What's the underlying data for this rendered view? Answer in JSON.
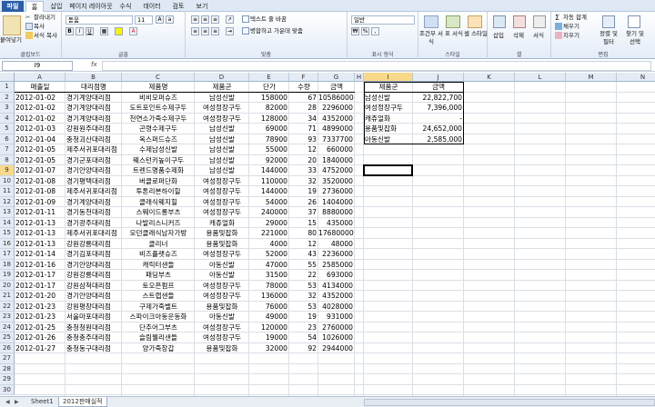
{
  "ribbon_tabs": [
    "파일",
    "홈",
    "삽입",
    "페이지 레이아웃",
    "수식",
    "데이터",
    "검토",
    "보기"
  ],
  "ribbon": {
    "clipboard": {
      "paste": "붙여넣기",
      "cut": "잘라내기",
      "copy": "복사",
      "format_painter": "서식 복사",
      "label": "클립보드"
    },
    "font": {
      "name": "돋움",
      "size": "11",
      "label": "글꼴"
    },
    "alignment": {
      "wrap": "텍스트 줄 바꿈",
      "merge": "병합하고 가운데 맞춤",
      "label": "맞춤"
    },
    "number": {
      "format": "일반",
      "label": "표시 형식"
    },
    "styles": {
      "conditional": "조건부 서식",
      "table": "표 서식",
      "cell": "셀 스타일",
      "label": "스타일"
    },
    "cells": {
      "insert": "삽입",
      "delete": "삭제",
      "format": "서식",
      "label": "셀"
    },
    "editing": {
      "autosum": "자동 합계",
      "fill": "채우기",
      "clear": "지우기",
      "sort": "정렬 및 필터",
      "find": "찾기 및 선택",
      "label": "편집"
    }
  },
  "formula_bar": {
    "name_box": "I9",
    "fx": "fx",
    "value": ""
  },
  "columns": [
    "A",
    "B",
    "C",
    "D",
    "E",
    "F",
    "G",
    "H",
    "I",
    "J",
    "K",
    "L",
    "M",
    "N"
  ],
  "headers": [
    "매출일",
    "대리점명",
    "제품명",
    "제품군",
    "단가",
    "수량",
    "금액"
  ],
  "rows": [
    [
      "2012-01-02",
      "경기계양대리점",
      "비비모퍼슈즈",
      "남성신발",
      "158000",
      "67",
      "10586000"
    ],
    [
      "2012-01-02",
      "경기계양대리점",
      "도트포인트수제구두",
      "여성정장구두",
      "82000",
      "28",
      "2296000"
    ],
    [
      "2012-01-02",
      "경기계양대리점",
      "천연소가죽수제구두",
      "여성정장구두",
      "128000",
      "34",
      "4352000"
    ],
    [
      "2012-01-03",
      "강원원주대리점",
      "곤령수제구두",
      "남성신발",
      "69000",
      "71",
      "4899000"
    ],
    [
      "2012-01-04",
      "충청괴산대리점",
      "옥스퍼드슈즈",
      "남성신발",
      "78900",
      "93",
      "7337700"
    ],
    [
      "2012-01-05",
      "제주서귀포대리점",
      "수제남성신발",
      "남성신발",
      "55000",
      "12",
      "660000"
    ],
    [
      "2012-01-05",
      "경기군포대리점",
      "웨스턴키높이구두",
      "남성신발",
      "92000",
      "20",
      "1840000"
    ],
    [
      "2012-01-07",
      "경기안양대리점",
      "트렌드명품수제화",
      "남성신발",
      "144000",
      "33",
      "4752000"
    ],
    [
      "2012-01-08",
      "경기평택대리점",
      "버클로퍼단화",
      "여성정장구두",
      "110000",
      "32",
      "3520000"
    ],
    [
      "2012-01-08",
      "제주서귀포대리점",
      "투톤리본하이힐",
      "여성정장구두",
      "144000",
      "19",
      "2736000"
    ],
    [
      "2012-01-09",
      "경기계양대리점",
      "클래식웨지힐",
      "여성정장구두",
      "54000",
      "26",
      "1404000"
    ],
    [
      "2012-01-11",
      "경기동천대리점",
      "스웨이드롱부츠",
      "여성정장구두",
      "240000",
      "37",
      "8880000"
    ],
    [
      "2012-01-13",
      "경기광주대리점",
      "나발리스니커즈",
      "캐쥬얼화",
      "29000",
      "15",
      "435000"
    ],
    [
      "2012-01-13",
      "제주서귀포대리점",
      "모던클래식남자가방",
      "용품및잡화",
      "221000",
      "80",
      "17680000"
    ],
    [
      "2012-01-13",
      "강원강릉대리점",
      "클리너",
      "용품및잡화",
      "4000",
      "12",
      "48000"
    ],
    [
      "2012-01-14",
      "경기김포대리점",
      "비즈플랫슈즈",
      "여성정장구두",
      "52000",
      "43",
      "2236000"
    ],
    [
      "2012-01-16",
      "경기안양대리점",
      "캐릭터샌들",
      "아동신발",
      "47000",
      "55",
      "2585000"
    ],
    [
      "2012-01-17",
      "강원강릉대리점",
      "패딩부츠",
      "아동신발",
      "31500",
      "22",
      "693000"
    ],
    [
      "2012-01-17",
      "강원삼척대리점",
      "토오픈펌프",
      "여성정장구두",
      "78000",
      "53",
      "4134000"
    ],
    [
      "2012-01-20",
      "경기안양대리점",
      "스트랩샌들",
      "여성정장구두",
      "136000",
      "32",
      "4352000"
    ],
    [
      "2012-01-23",
      "강원평창대리점",
      "구제가죽벨트",
      "용품및잡화",
      "76000",
      "53",
      "4028000"
    ],
    [
      "2012-01-23",
      "서울마포대리점",
      "스파이크아동운동화",
      "아동신발",
      "49000",
      "19",
      "931000"
    ],
    [
      "2012-01-25",
      "충청청원대리점",
      "단추어그부츠",
      "여성정장구두",
      "120000",
      "23",
      "2760000"
    ],
    [
      "2012-01-26",
      "충청충주대리점",
      "슬림웰리샌들",
      "여성정장구두",
      "19000",
      "54",
      "1026000"
    ],
    [
      "2012-01-27",
      "충청동구대리점",
      "양가죽장갑",
      "용품및잡화",
      "32000",
      "92",
      "2944000"
    ]
  ],
  "summary": {
    "headers": [
      "제품군",
      "금액"
    ],
    "rows": [
      [
        "남성신발",
        "22,822,700"
      ],
      [
        "여성정장구두",
        "7,396,000"
      ],
      [
        "캐쥬얼화",
        "-"
      ],
      [
        "용품및잡화",
        "24,652,000"
      ],
      [
        "아동신발",
        "2,585,000"
      ]
    ]
  },
  "sheets": [
    "Sheet1",
    "2012판매실적"
  ]
}
